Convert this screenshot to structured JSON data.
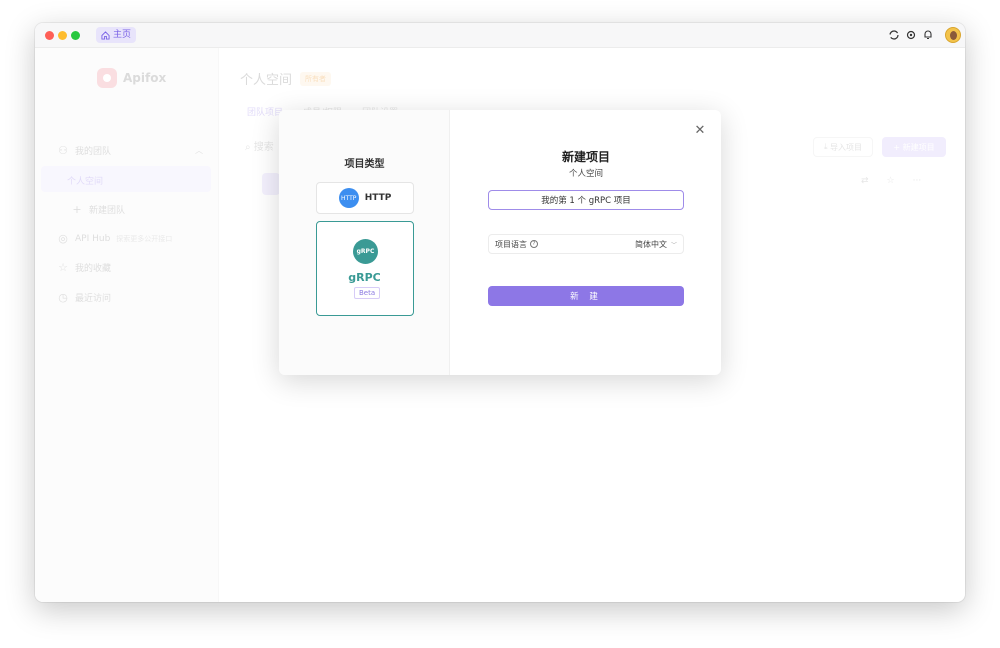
{
  "titlebar": {
    "home_tab": "主页",
    "icons": [
      "refresh-icon",
      "gear-icon",
      "bell-icon",
      "avatar"
    ]
  },
  "sidebar": {
    "logo_text": "Apifox",
    "items": [
      {
        "label": "我的团队",
        "icon": "team-icon"
      },
      {
        "label": "个人空间",
        "icon": ""
      },
      {
        "label": "新建团队",
        "icon": "plus-icon"
      },
      {
        "label": "API Hub",
        "sub": "探索更多公开接口",
        "icon": "compass-icon"
      },
      {
        "label": "我的收藏",
        "icon": "star-icon"
      },
      {
        "label": "最近访问",
        "icon": "clock-icon"
      }
    ]
  },
  "main": {
    "title": "个人空间",
    "owner_badge": "所有者",
    "tabs": [
      "团队项目",
      "成员/权限",
      "团队设置"
    ],
    "search_placeholder": "搜索",
    "import_label": "导入项目",
    "new_label": "新建项目"
  },
  "modal": {
    "type_title": "项目类型",
    "types": [
      {
        "label": "HTTP",
        "icon_text": "HTTP"
      },
      {
        "label": "gRPC",
        "icon_text": "gRPC",
        "badge": "Beta"
      }
    ],
    "title": "新建项目",
    "subtitle": "个人空间",
    "name_value": "我的第 1 个 gRPC 项目",
    "language_label": "项目语言",
    "language_value": "简体中文",
    "create_label": "新 建"
  },
  "colors": {
    "accent": "#8d77e6",
    "grpc": "#3a9a95",
    "http": "#3c8ef0"
  }
}
